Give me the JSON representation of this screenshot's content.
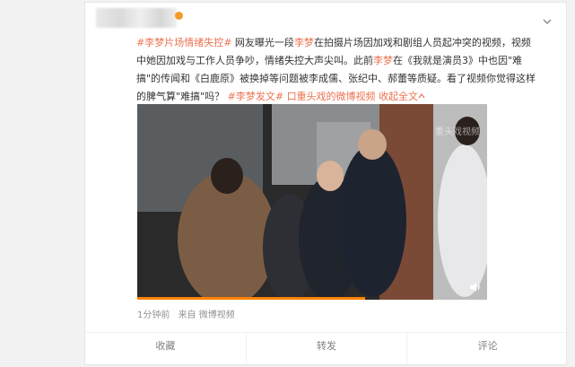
{
  "post": {
    "tags": {
      "topic": "#李梦片场情绪失控#",
      "name1": "李梦",
      "name2": "李梦",
      "topic2": "#李梦发文#"
    },
    "text": {
      "p1": " 网友曝光一段",
      "p2": "在拍摄片场因加戏和剧组人员起冲突的视频，视频中她因加戏与工作人员争吵，情绪失控大声尖叫。此前",
      "p3": "在《我就是演员3》中也因\"难搞\"的传闻和《白鹿原》被换掉等问题被李成儒、张纪中、郝蕾等质疑。看了视频你觉得这样的脾气算\"难搞\"吗？"
    },
    "link": {
      "icon": "video-link-icon",
      "label": "口重头戏的微博视频"
    },
    "expand_label": "收起全文",
    "expand_icon": "arrow-up-icon",
    "video": {
      "watermark": "重头戏视频",
      "progress_percent": 65
    },
    "meta": {
      "time": "1分钟前",
      "source": "来自 微博视频"
    }
  },
  "actions": [
    {
      "label": "收藏"
    },
    {
      "label": "转发"
    },
    {
      "label": "评论"
    }
  ],
  "colors": {
    "accent": "#eb7350",
    "progress": "#ff8200",
    "muted": "#939393"
  }
}
